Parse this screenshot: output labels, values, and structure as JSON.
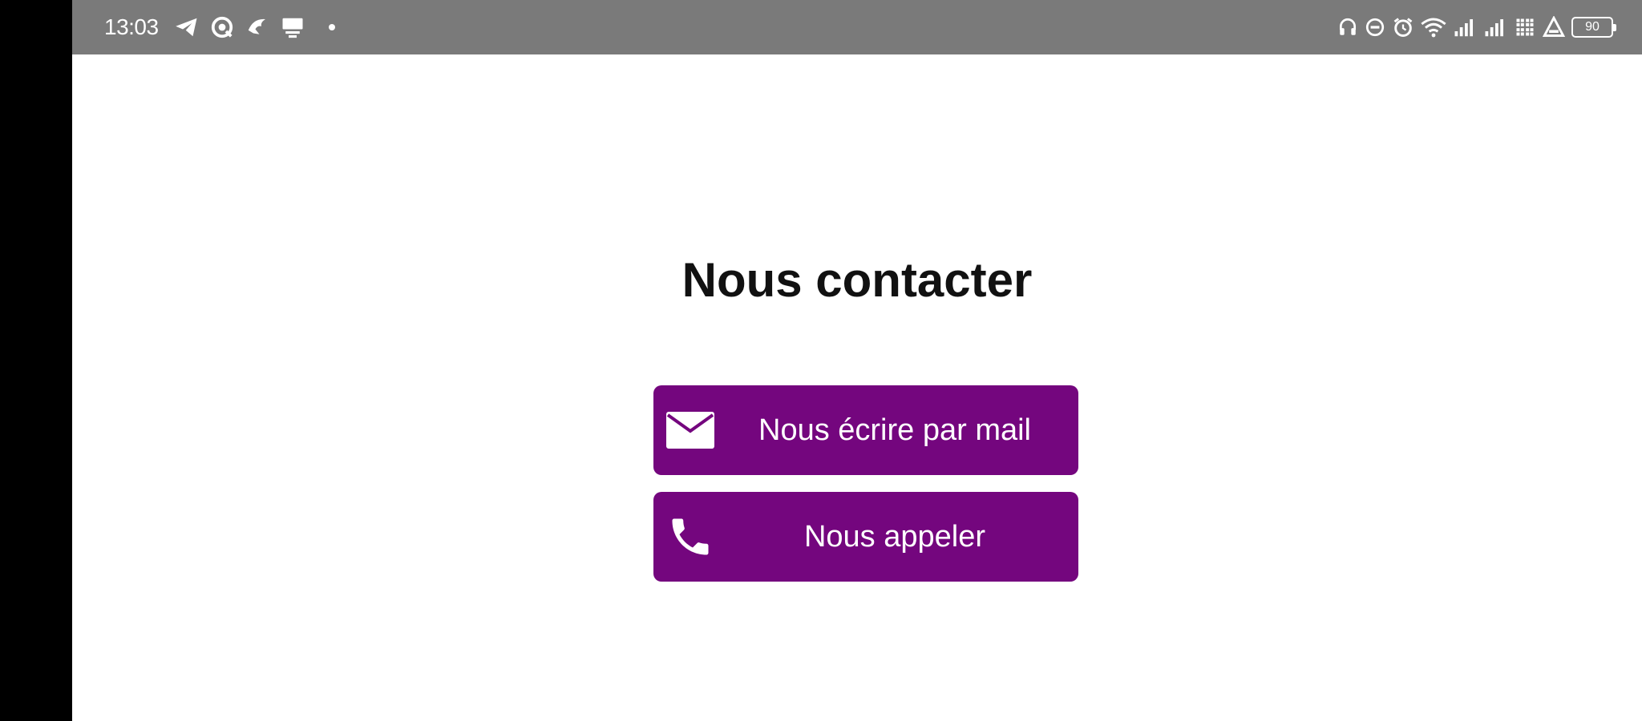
{
  "status_bar": {
    "time": "13:03",
    "battery_level": "90",
    "left_icons": [
      "telegram-icon",
      "sync-icon",
      "bird-icon",
      "cast-icon",
      "notification-dot"
    ],
    "right_icons": [
      "headset-icon",
      "do-not-disturb-icon",
      "alarm-icon",
      "wifi-icon",
      "signal-icon",
      "signal-icon",
      "data-icon",
      "triangle-warning-icon",
      "battery-icon"
    ],
    "background_color": "#7a7a7a"
  },
  "page": {
    "title": "Nous contacter"
  },
  "buttons": {
    "mail": {
      "label": "Nous écrire par mail",
      "icon": "mail-icon"
    },
    "call": {
      "label": "Nous appeler",
      "icon": "phone-icon"
    },
    "color": "#74067e"
  }
}
